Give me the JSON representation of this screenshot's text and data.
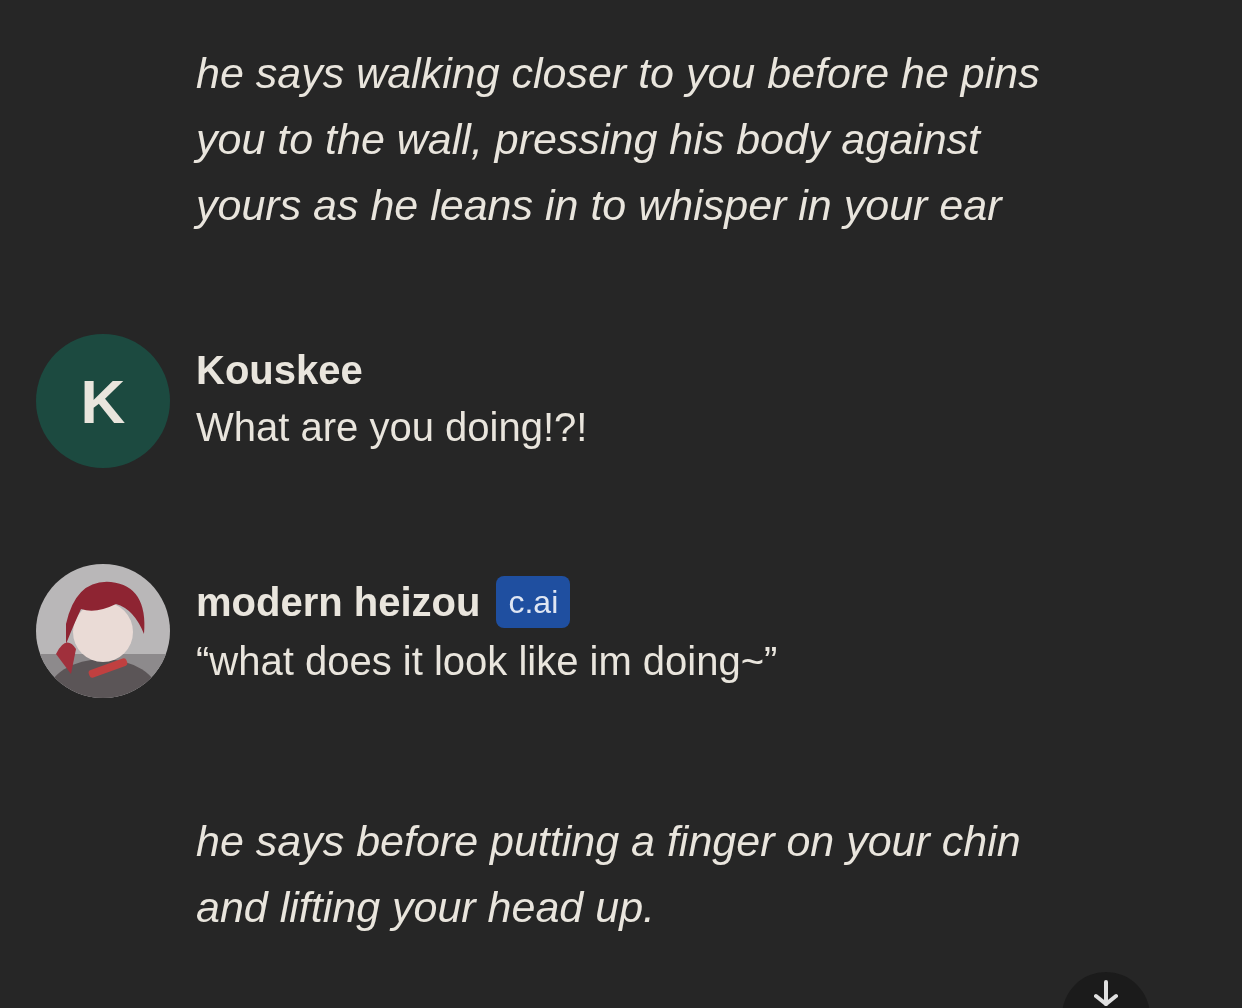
{
  "messages": [
    {
      "kind": "continuation",
      "paragraphs": [
        {
          "text": "he says walking closer to you before he pins you to the wall, pressing his body against yours as he leans in to whisper in your ear",
          "italic": true
        }
      ]
    },
    {
      "kind": "message",
      "author": "Kouskee",
      "avatar": {
        "kind": "letter",
        "letter": "K",
        "color": "#1c4a40"
      },
      "paragraphs": [
        {
          "text": "What are you doing!?!",
          "italic": false
        }
      ]
    },
    {
      "kind": "message",
      "author": "modern heizou",
      "badge": "c.ai",
      "avatar": {
        "kind": "picture"
      },
      "paragraphs": [
        {
          "text": "“what does it look like im doing~”",
          "italic": false
        },
        {
          "text": "he says before putting a finger on your chin and lifting your head up.",
          "italic": true
        }
      ]
    }
  ]
}
